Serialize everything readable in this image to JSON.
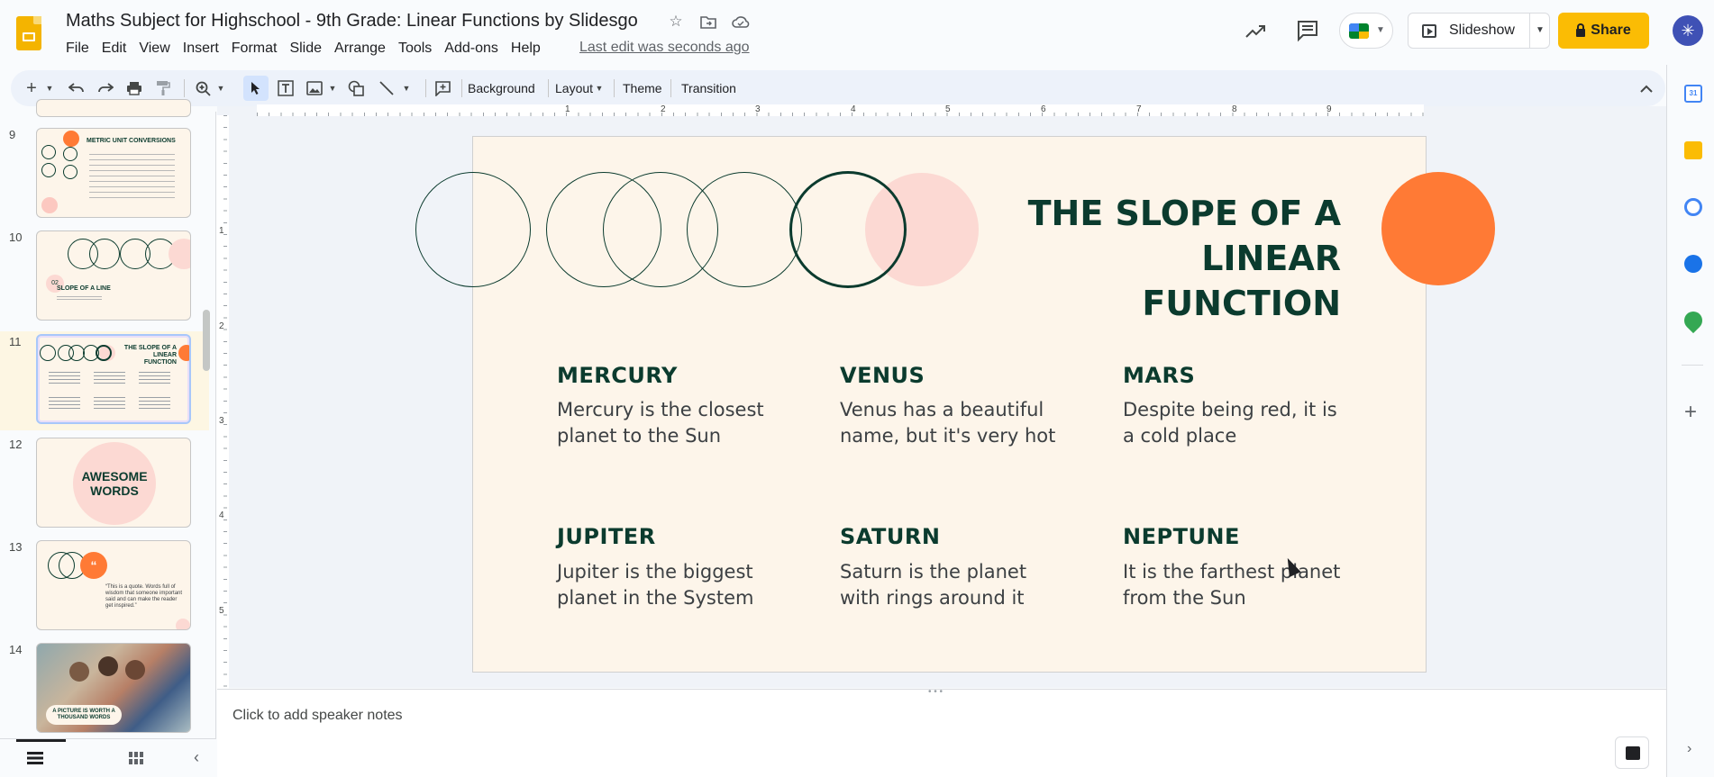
{
  "app": {
    "doc_title": "Maths Subject for Highschool - 9th Grade: Linear Functions by Slidesgo",
    "last_edit": "Last edit was seconds ago"
  },
  "menu": [
    "File",
    "Edit",
    "View",
    "Insert",
    "Format",
    "Slide",
    "Arrange",
    "Tools",
    "Add-ons",
    "Help"
  ],
  "header_actions": {
    "slideshow_label": "Slideshow",
    "share_label": "Share"
  },
  "toolbar": {
    "background_label": "Background",
    "layout_label": "Layout",
    "theme_label": "Theme",
    "transition_label": "Transition"
  },
  "rulers": {
    "horizontal": [
      "1",
      "2",
      "3",
      "4",
      "5",
      "6",
      "7",
      "8",
      "9"
    ],
    "vertical": [
      "1",
      "2",
      "3",
      "4",
      "5"
    ]
  },
  "thumbnails": [
    {
      "num": "9",
      "title": "METRIC UNIT CONVERSIONS"
    },
    {
      "num": "10",
      "title": "SLOPE OF A LINE",
      "badge": "02"
    },
    {
      "num": "11",
      "title": "THE SLOPE OF A LINEAR FUNCTION",
      "selected": true
    },
    {
      "num": "12",
      "title": "AWESOME WORDS"
    },
    {
      "num": "13",
      "title": "“This is a quote. Words full of wisdom that someone important said and can make the reader get inspired.”"
    },
    {
      "num": "14",
      "title": "A PICTURE IS WORTH A THOUSAND WORDS"
    }
  ],
  "slide": {
    "title_line1": "THE SLOPE OF A",
    "title_line2": "LINEAR FUNCTION",
    "planets": [
      {
        "name": "MERCURY",
        "line1": "Mercury is the closest",
        "line2": "planet to the Sun"
      },
      {
        "name": "VENUS",
        "line1": "Venus has a beautiful",
        "line2": "name, but it's very hot"
      },
      {
        "name": "MARS",
        "line1": "Despite being red, it is",
        "line2": "a cold place"
      },
      {
        "name": "JUPITER",
        "line1": "Jupiter is the biggest",
        "line2": "planet in the System"
      },
      {
        "name": "SATURN",
        "line1": "Saturn is the planet",
        "line2": "with rings around it"
      },
      {
        "name": "NEPTUNE",
        "line1": "It is the farthest planet",
        "line2": "from the Sun"
      }
    ],
    "colors": {
      "dark_green": "#0b3b2e",
      "orange": "#ff7a35",
      "pink": "#fcd9d3",
      "cream": "#fdf5ea"
    }
  },
  "notes": {
    "placeholder": "Click to add speaker notes"
  },
  "right_panel": {
    "icons": [
      "calendar-icon",
      "keep-icon",
      "tasks-icon",
      "contacts-icon",
      "maps-icon"
    ]
  }
}
